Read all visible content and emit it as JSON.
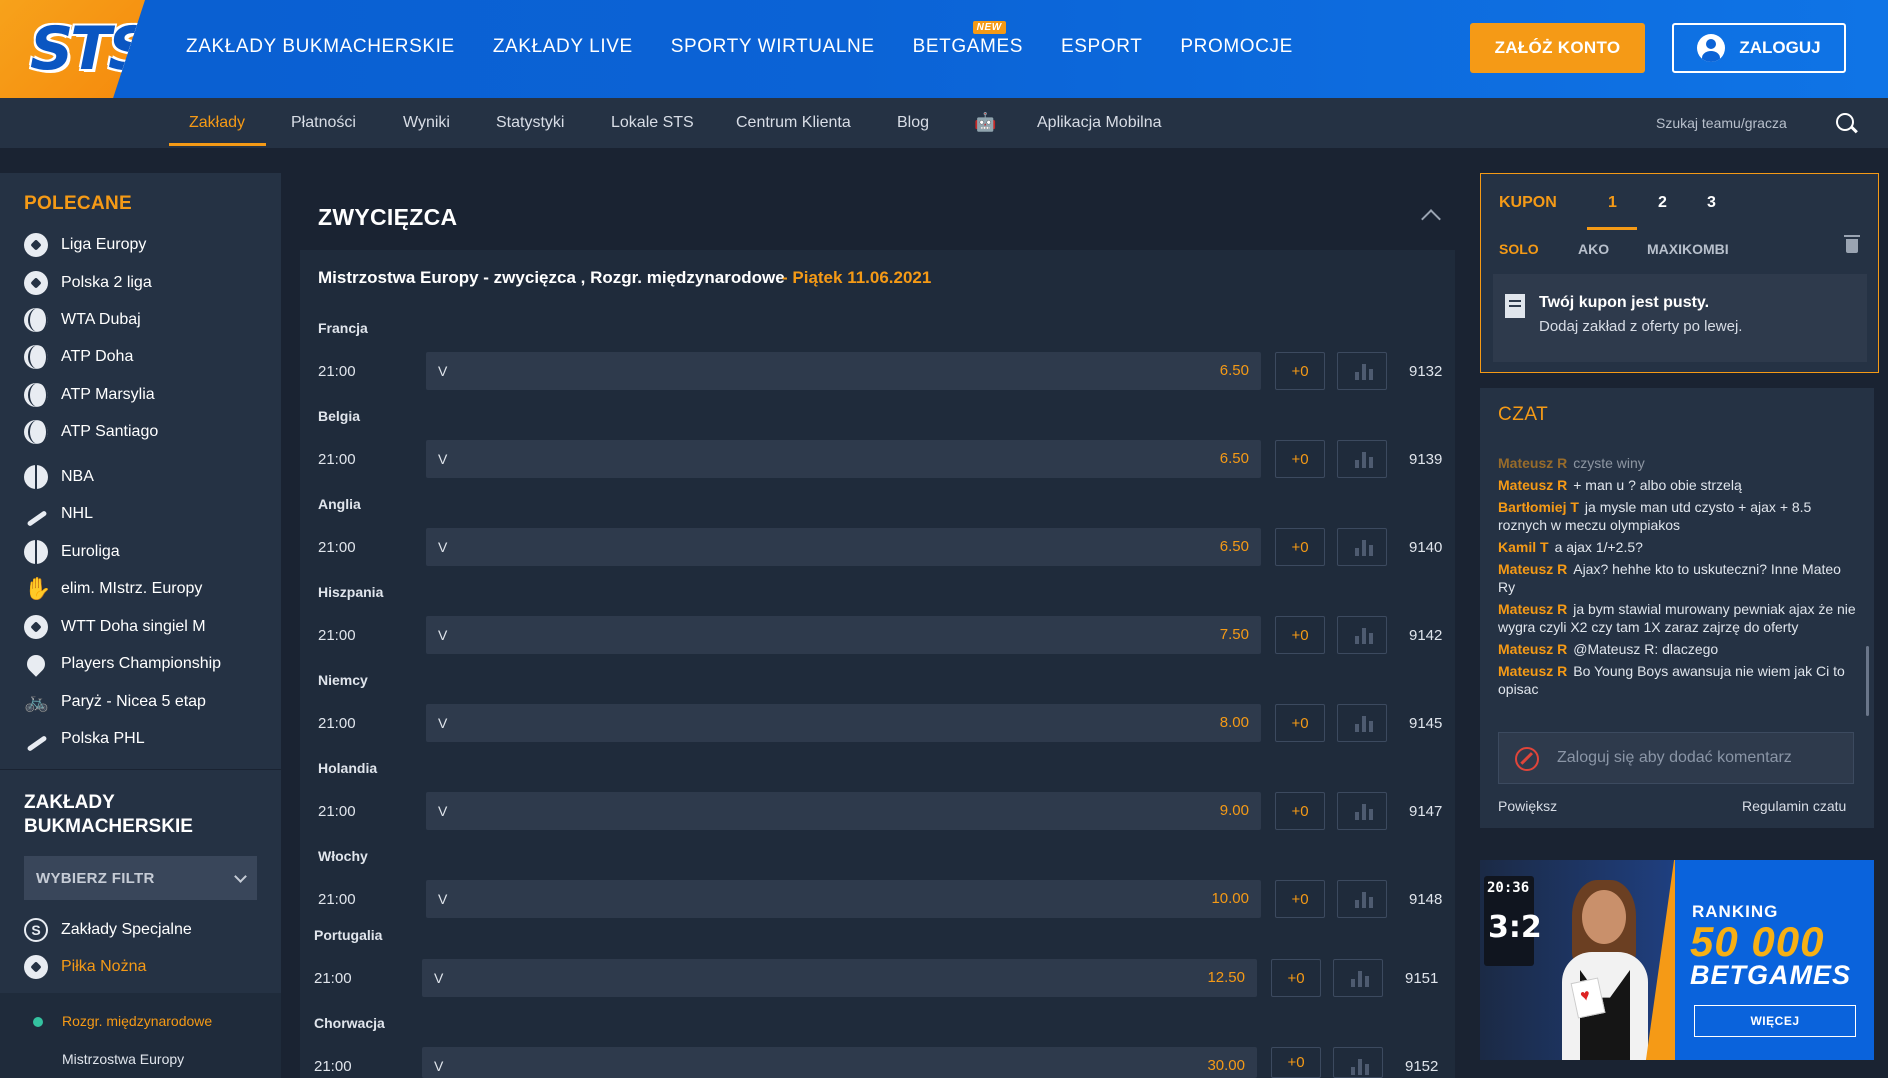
{
  "header": {
    "logo": "STS",
    "nav": [
      {
        "label": "ZAKŁADY BUKMACHERSKIE"
      },
      {
        "label": "ZAKŁADY LIVE"
      },
      {
        "label": "SPORTY WIRTUALNE"
      },
      {
        "label": "BETGAMES",
        "badge": "NEW"
      },
      {
        "label": "ESPORT"
      },
      {
        "label": "PROMOCJE"
      }
    ],
    "register_label": "ZAŁÓŻ KONTO",
    "login_label": "ZALOGUJ"
  },
  "subnav": {
    "items": [
      {
        "label": "Zakłady"
      },
      {
        "label": "Płatności"
      },
      {
        "label": "Wyniki"
      },
      {
        "label": "Statystyki"
      },
      {
        "label": "Lokale STS"
      },
      {
        "label": "Centrum Klienta"
      },
      {
        "label": "Blog"
      },
      {
        "label": "Aplikacja Mobilna"
      }
    ],
    "search_placeholder": "Szukaj teamu/gracza"
  },
  "sidebar": {
    "recommended_title": "POLECANE",
    "items": [
      {
        "label": "Liga Europy",
        "icon": "soccer-ball-icon"
      },
      {
        "label": "Polska 2 liga",
        "icon": "soccer-ball-icon"
      },
      {
        "label": "WTA Dubaj",
        "icon": "tennis-ball-icon"
      },
      {
        "label": "ATP Doha",
        "icon": "tennis-ball-icon"
      },
      {
        "label": "ATP Marsylia",
        "icon": "tennis-ball-icon"
      },
      {
        "label": "ATP Santiago",
        "icon": "tennis-ball-icon"
      },
      {
        "label": "NBA",
        "icon": "basketball-icon"
      },
      {
        "label": "NHL",
        "icon": "hockey-stick-icon"
      },
      {
        "label": "Euroliga",
        "icon": "basketball-icon"
      },
      {
        "label": "elim. MIstrz. Europy",
        "icon": "handball-icon"
      },
      {
        "label": "WTT Doha singiel M",
        "icon": "table-tennis-icon"
      },
      {
        "label": "Players Championship",
        "icon": "golf-icon"
      },
      {
        "label": "Paryż - Nicea 5 etap",
        "icon": "bicycle-icon"
      },
      {
        "label": "Polska PHL",
        "icon": "hockey-stick-icon"
      }
    ],
    "bets_title": "ZAKŁADY BUKMACHERSKIE",
    "filter_label": "WYBIERZ FILTR",
    "categories": [
      {
        "label": "Zakłady Specjalne",
        "icon": "special-bets-icon"
      },
      {
        "label": "Piłka Nożna",
        "icon": "soccer-ball-icon"
      }
    ],
    "sub_items": [
      {
        "label": "Rozgr. międzynarodowe"
      },
      {
        "label": "Mistrzostwa Europy"
      }
    ]
  },
  "main": {
    "section_title": "ZWYCIĘZCA",
    "competition": "Mistrzostwa Europy - zwycięzca , Rozgr. międzynarodowe",
    "date": "- Piątek 11.06.2021",
    "events": [
      {
        "team": "Francja",
        "time": "21:00",
        "bet": "V",
        "odd": "6.50",
        "plus": "+0",
        "id": "9132"
      },
      {
        "team": "Belgia",
        "time": "21:00",
        "bet": "V",
        "odd": "6.50",
        "plus": "+0",
        "id": "9139"
      },
      {
        "team": "Anglia",
        "time": "21:00",
        "bet": "V",
        "odd": "6.50",
        "plus": "+0",
        "id": "9140"
      },
      {
        "team": "Hiszpania",
        "time": "21:00",
        "bet": "V",
        "odd": "7.50",
        "plus": "+0",
        "id": "9142"
      },
      {
        "team": "Niemcy",
        "time": "21:00",
        "bet": "V",
        "odd": "8.00",
        "plus": "+0",
        "id": "9145"
      },
      {
        "team": "Holandia",
        "time": "21:00",
        "bet": "V",
        "odd": "9.00",
        "plus": "+0",
        "id": "9147"
      },
      {
        "team": "Włochy",
        "time": "21:00",
        "bet": "V",
        "odd": "10.00",
        "plus": "+0",
        "id": "9148"
      },
      {
        "team": "Portugalia",
        "time": "21:00",
        "bet": "V",
        "odd": "12.50",
        "plus": "+0",
        "id": "9151"
      },
      {
        "team": "Chorwacja",
        "time": "21:00",
        "bet": "V",
        "odd": "30.00",
        "plus": "+0",
        "id": "9152"
      }
    ]
  },
  "coupon": {
    "title": "KUPON",
    "tabs": [
      "1",
      "2",
      "3"
    ],
    "types": [
      "SOLO",
      "AKO",
      "MAXIKOMBI"
    ],
    "empty_title": "Twój kupon jest pusty.",
    "empty_sub": "Dodaj zakład z oferty po lewej."
  },
  "chat": {
    "title": "CZAT",
    "messages": [
      {
        "user": "Mateusz R",
        "text": "czyste winy"
      },
      {
        "user": "Mateusz R",
        "text": "+ man u ? albo obie strzelą"
      },
      {
        "user": "Bartłomiej T",
        "text": "ja mysle man utd czysto + ajax + 8.5 roznych w meczu olympiakos"
      },
      {
        "user": "Kamil T",
        "text": "a ajax 1/+2.5?"
      },
      {
        "user": "Mateusz R",
        "text": "Ajax? hehhe kto to uskuteczni? Inne Mateo Ry"
      },
      {
        "user": "Mateusz R",
        "text": "ja bym stawial murowany pewniak ajax że nie wygra czyli X2 czy tam 1X zaraz zajrzę do oferty"
      },
      {
        "user": "Mateusz R",
        "text": "@Mateusz R: dlaczego"
      },
      {
        "user": "Mateusz R",
        "text": "Bo Young Boys awansuja nie wiem jak Ci to opisac"
      }
    ],
    "input_placeholder": "Zaloguj się aby dodać komentarz",
    "expand_label": "Powiększ",
    "rules_label": "Regulamin czatu"
  },
  "banner": {
    "score_time": "20:36",
    "score": "3:2",
    "ranking_label": "RANKING",
    "amount": "50 000",
    "brand": "BETGAMES",
    "button": "WIĘCEJ"
  },
  "colors": {
    "accent": "#f59a16",
    "header_blue": "#0b63d6",
    "bg_dark": "#1a2332"
  }
}
